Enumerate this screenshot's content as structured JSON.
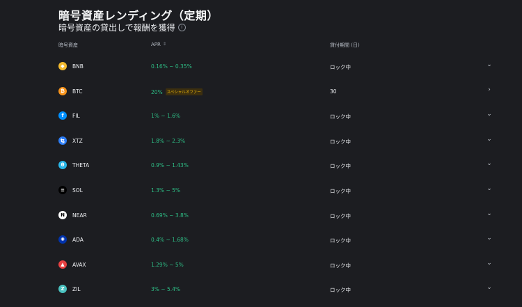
{
  "page": {
    "title": "暗号資産レンディング（定期）",
    "subtitle": "暗号資産の貸出しで報酬を獲得"
  },
  "table": {
    "columns": [
      "暗号資産",
      "APR",
      "貸付期間 (日)"
    ],
    "rows": [
      {
        "coin": "BNB",
        "icon_color": "#f3ba2f",
        "icon_glyph": "◆",
        "apr": "0.16% ~ 0.35%",
        "badge": "",
        "duration": "ロック中",
        "action_icon": "chevron-down-icon",
        "action_glyph": "⌄"
      },
      {
        "coin": "BTC",
        "icon_color": "#f7931a",
        "icon_glyph": "₿",
        "apr": "20%",
        "badge": "スペシャルオファー",
        "duration": "30",
        "action_icon": "chevron-right-icon",
        "action_glyph": "›"
      },
      {
        "coin": "FIL",
        "icon_color": "#0090ff",
        "icon_glyph": "f",
        "apr": "1% ~ 1.6%",
        "badge": "",
        "duration": "ロック中",
        "action_icon": "chevron-down-icon",
        "action_glyph": "⌄"
      },
      {
        "coin": "XTZ",
        "icon_color": "#2c7df7",
        "icon_glyph": "ꜩ",
        "apr": "1.8% ~ 2.3%",
        "badge": "",
        "duration": "ロック中",
        "action_icon": "chevron-down-icon",
        "action_glyph": "⌄"
      },
      {
        "coin": "THETA",
        "icon_color": "#29b6e8",
        "icon_glyph": "θ",
        "apr": "0.9% ~ 1.43%",
        "badge": "",
        "duration": "ロック中",
        "action_icon": "chevron-down-icon",
        "action_glyph": "⌄"
      },
      {
        "coin": "SOL",
        "icon_color": "#000000",
        "icon_glyph": "≡",
        "apr": "1.3% ~ 5%",
        "badge": "",
        "duration": "ロック中",
        "action_icon": "chevron-down-icon",
        "action_glyph": "⌄"
      },
      {
        "coin": "NEAR",
        "icon_color": "#ffffff",
        "icon_glyph": "N",
        "apr": "0.69% ~ 3.8%",
        "badge": "",
        "duration": "ロック中",
        "action_icon": "chevron-down-icon",
        "action_glyph": "⌄"
      },
      {
        "coin": "ADA",
        "icon_color": "#0033ad",
        "icon_glyph": "✺",
        "apr": "0.4% ~ 1.68%",
        "badge": "",
        "duration": "ロック中",
        "action_icon": "chevron-down-icon",
        "action_glyph": "⌄"
      },
      {
        "coin": "AVAX",
        "icon_color": "#e84142",
        "icon_glyph": "▲",
        "apr": "1.29% ~ 5%",
        "badge": "",
        "duration": "ロック中",
        "action_icon": "chevron-down-icon",
        "action_glyph": "⌄"
      },
      {
        "coin": "ZIL",
        "icon_color": "#49c1bf",
        "icon_glyph": "Z",
        "apr": "3% ~ 5.4%",
        "badge": "",
        "duration": "ロック中",
        "action_icon": "chevron-down-icon",
        "action_glyph": "⌄"
      }
    ]
  }
}
